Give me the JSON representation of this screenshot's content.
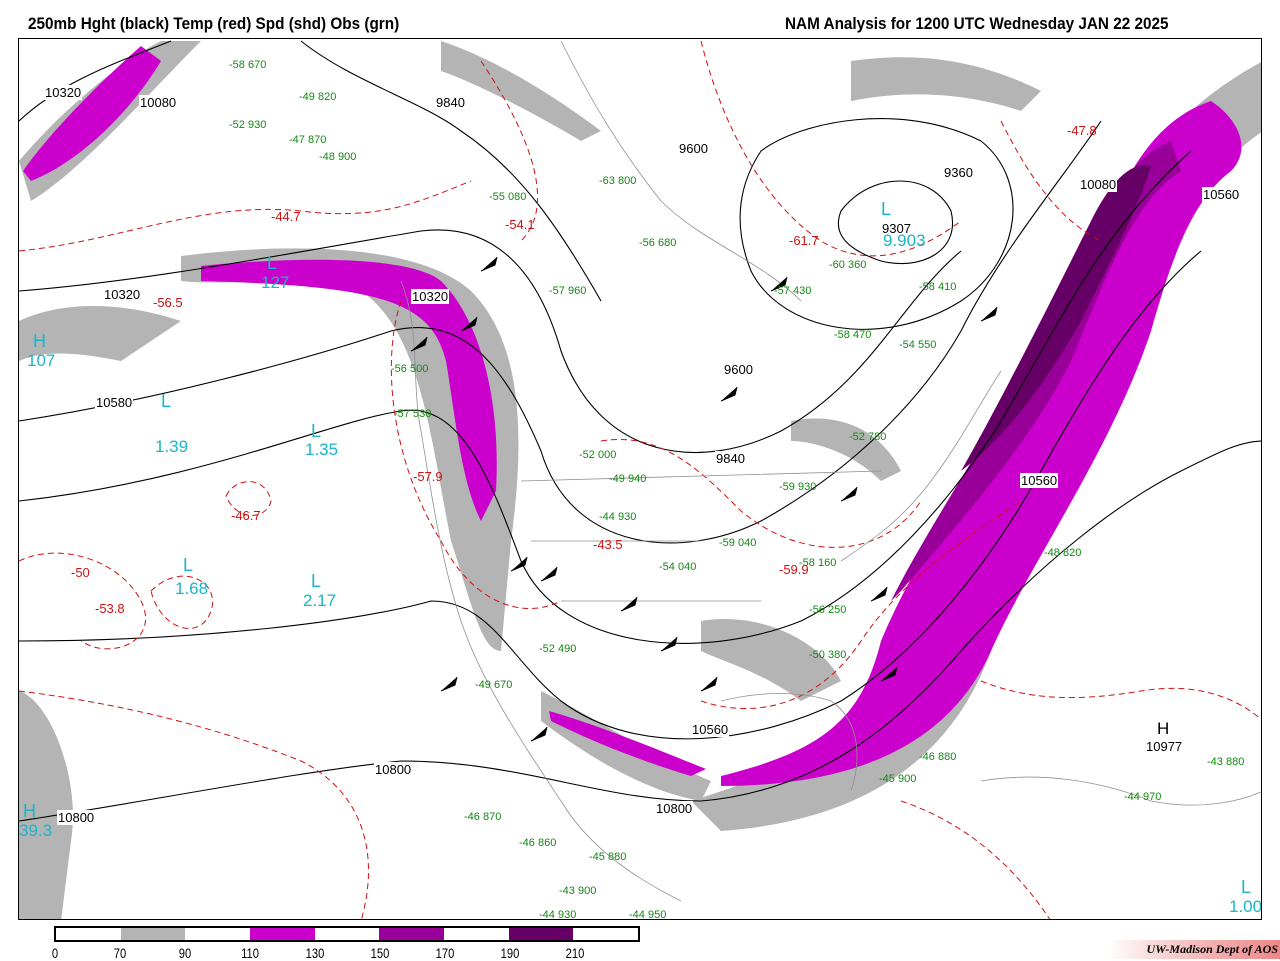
{
  "header": {
    "title_left": "250mb Hght (black) Temp (red) Spd (shd) Obs (grn)",
    "title_right": "NAM Analysis for 1200 UTC Wednesday  JAN 22 2025"
  },
  "legend": {
    "ticks": [
      "0",
      "70",
      "90",
      "110",
      "130",
      "150",
      "170",
      "190",
      "210"
    ],
    "colors": [
      "#ffffff",
      "#b4b4b4",
      "#ffffff",
      "#cc00cc",
      "#ffffff",
      "#990099",
      "#ffffff",
      "#660066",
      "#ffffff"
    ]
  },
  "credit": "UW-Madison  Dept of AOS",
  "height_labels": [
    "10320",
    "9840",
    "9600",
    "9360",
    "9307",
    "10080",
    "10560",
    "10320",
    "10580",
    "9600",
    "9840",
    "10560",
    "10800",
    "10977",
    "10800",
    "10080",
    "10560",
    "10800",
    "10320"
  ],
  "centers": [
    {
      "letter": "L",
      "value": "1.39"
    },
    {
      "letter": "L",
      "value": "1.35"
    },
    {
      "letter": "L",
      "value": "1.68"
    },
    {
      "letter": "L",
      "value": "2.17"
    },
    {
      "letter": "L",
      "value": "127"
    },
    {
      "letter": "H",
      "value": "107"
    },
    {
      "letter": "H",
      "value": "39.3"
    },
    {
      "letter": "L",
      "value": "9.903"
    },
    {
      "letter": "H",
      "value": "10977"
    },
    {
      "letter": "L",
      "value": "1.00"
    }
  ],
  "temp_labels": [
    "-44.7",
    "-56.5",
    "-54.1",
    "-61.7",
    "-46.7",
    "-57.9",
    "-53.8",
    "-50",
    "-43.5",
    "-59.9",
    "-47.8"
  ],
  "obs": [
    "-58 670",
    "-49 820",
    "-52 930",
    "-47 870",
    "-48 900",
    "-55 080",
    "-63 800",
    "-56 680",
    "-57 960",
    "-57 430",
    "-60 360",
    "-58 410",
    "-58 470",
    "-54 550",
    "-56 500",
    "-57 530",
    "-52 000",
    "-49 940",
    "-44 930",
    "-59 040",
    "-58 160",
    "-56 250",
    "-50 380",
    "-46 880",
    "-45 900",
    "-48 820",
    "-43 880",
    "-44 970",
    "-46 860",
    "-45 880",
    "-43 900",
    "-44 930",
    "-44 950",
    "-54 040",
    "-52 490",
    "-49 670",
    "-46 870",
    "-52 780",
    "-59 930"
  ]
}
